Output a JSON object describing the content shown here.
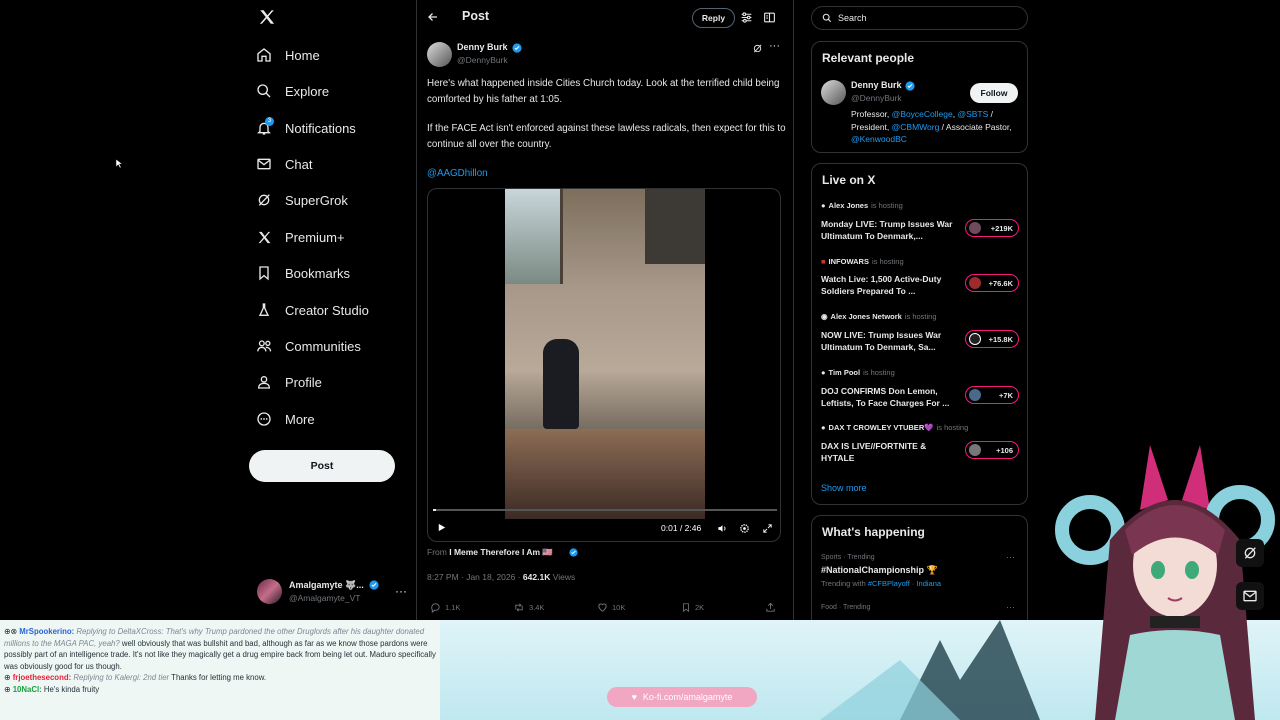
{
  "nav": {
    "items": [
      {
        "label": "Home",
        "icon": "home-icon"
      },
      {
        "label": "Explore",
        "icon": "search-icon"
      },
      {
        "label": "Notifications",
        "icon": "bell-icon"
      },
      {
        "label": "Chat",
        "icon": "mail-icon"
      },
      {
        "label": "SuperGrok",
        "icon": "grok-icon"
      },
      {
        "label": "Premium+",
        "icon": "x-logo-icon"
      },
      {
        "label": "Bookmarks",
        "icon": "bookmark-icon"
      },
      {
        "label": "Creator Studio",
        "icon": "flask-icon"
      },
      {
        "label": "Communities",
        "icon": "people-icon"
      },
      {
        "label": "Profile",
        "icon": "person-icon"
      },
      {
        "label": "More",
        "icon": "more-circle-icon"
      }
    ],
    "notifications_badge": "3",
    "post_button": "Post",
    "account": {
      "name": "Amalgamyte 🐺...",
      "handle": "@Amalgamyte_VT"
    }
  },
  "header": {
    "title": "Post",
    "reply_label": "Reply"
  },
  "post": {
    "author_name": "Denny Burk",
    "author_handle": "@DennyBurk",
    "text_1": "Here's what happened inside Cities Church today. Look at the terrified child being comforted by his father at 1:05.",
    "text_2": "If the FACE Act isn't enforced against these lawless radicals, then expect for this to continue all over the country.",
    "mention": "@AAGDhillon",
    "video_time": "0:01 / 2:46",
    "video_progress": 0.006,
    "from_label": "From",
    "from_account": "I Meme Therefore I Am 🇺🇸",
    "timestamp": "8:27 PM · Jan 18, 2026 · ",
    "views": "642.1K",
    "views_label": " Views",
    "replies": "1.1K",
    "reposts": "3.4K",
    "likes": "10K",
    "bookmarks": "2K"
  },
  "search": {
    "placeholder": "Search"
  },
  "relevant": {
    "title": "Relevant people",
    "name": "Denny Burk",
    "handle": "@DennyBurk",
    "follow": "Follow",
    "bio_1": "Professor, ",
    "bio_link_1": "@BoyceCollege",
    "bio_2": ", ",
    "bio_link_2": "@SBTS",
    "bio_3": " / President, ",
    "bio_link_3": "@CBMWorg",
    "bio_4": " / Associate Pastor, ",
    "bio_link_4": "@KenwoodBC"
  },
  "live": {
    "title": "Live on X",
    "hosting": "is hosting",
    "items": [
      {
        "host": "Alex Jones",
        "title": "Monday LIVE: Trump Issues War Ultimatum To Denmark,...",
        "count": "+219K"
      },
      {
        "host": "INFOWARS",
        "title": "Watch Live: 1,500 Active-Duty Soldiers Prepared To ...",
        "count": "+76.6K"
      },
      {
        "host": "Alex Jones Network",
        "title": "NOW LIVE: Trump Issues War Ultimatum To Denmark, Sa...",
        "count": "+15.8K"
      },
      {
        "host": "Tim Pool",
        "title": "DOJ CONFIRMS Don Lemon, Leftists, To Face Charges For ...",
        "count": "+7K"
      },
      {
        "host": "DAX T CROWLEY VTUBER💜",
        "title": "DAX IS LIVE//FORTNITE & HYTALE",
        "count": "+106"
      }
    ],
    "show_more": "Show more"
  },
  "happening": {
    "title": "What's happening",
    "trend1_cat": "Sports · Trending",
    "trend1_name": "#NationalChampionship 🏆",
    "trend1_sub_prefix": "Trending with ",
    "trend1_sub_link1": "#CFBPlayoff",
    "trend1_sub_link2": "Indiana",
    "trend2_cat": "Food · Trending"
  },
  "stream": {
    "chat": [
      {
        "user": "MrSpookerino:",
        "reply": "Replying to DeltaXCross: That's why Trump pardoned the other Druglords after his daughter donated millions to the MAGA PAC, yeah?",
        "msg": " well obviously that was bullshit and bad, although as far as we know those pardons were possibly part of an intelligence trade. It's not like they magically get a drug empire back from being let out. Maduro specifically was obviously good for us though."
      },
      {
        "user": "frjoethesecond:",
        "reply": "Replying to Kalergi: 2nd tier",
        "msg": " Thanks for letting me know."
      },
      {
        "user": "10NaCl:",
        "reply": "",
        "msg": " He's kinda fruity"
      }
    ],
    "kofi": "Ko-fi.com/amalgamyte"
  }
}
